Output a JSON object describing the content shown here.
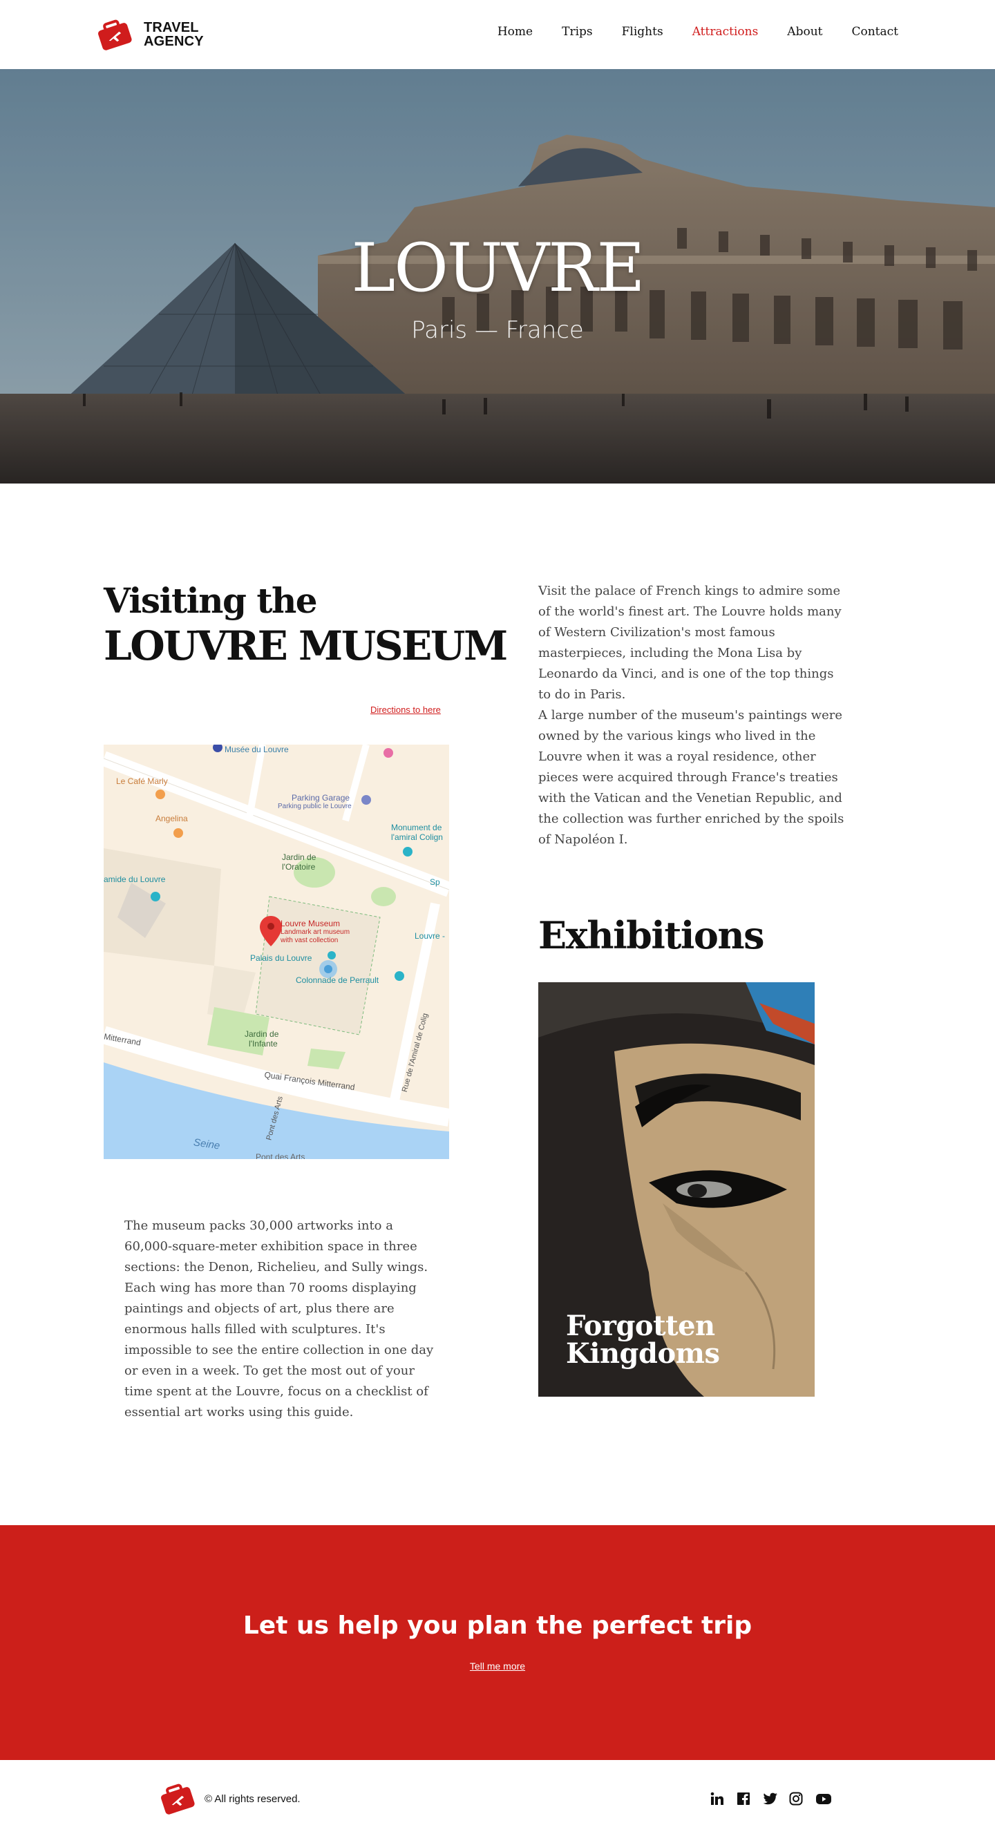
{
  "brand": {
    "name_line1": "TRAVEL",
    "name_line2": "AGENCY",
    "logo_icon": "suitcase-plane-icon",
    "color": "#d01c1c"
  },
  "nav": {
    "items": [
      {
        "label": "Home",
        "active": false
      },
      {
        "label": "Trips",
        "active": false
      },
      {
        "label": "Flights",
        "active": false
      },
      {
        "label": "Attractions",
        "active": true
      },
      {
        "label": "About",
        "active": false
      },
      {
        "label": "Contact",
        "active": false
      }
    ]
  },
  "hero": {
    "title": "LOUVRE",
    "subtitle": "Paris — France"
  },
  "visiting": {
    "heading_line1": "Visiting the",
    "heading_line2": "LOUVRE MUSEUM",
    "directions_link": "Directions to here",
    "paragraph1": "Visit the palace of French kings to admire some of the world's finest art. The Louvre holds many of Western Civilization's most famous masterpieces, including the Mona Lisa by Leonardo da Vinci, and is one of the top things to do in Paris.",
    "paragraph2": "A large number of the museum's paintings were owned by the various kings who lived in the Louvre when it was a royal residence, other pieces were acquired through France's treaties with the Vatican and the Venetian Republic, and the collection was further enriched by the spoils of Napoléon I.",
    "paragraph3": "The museum packs 30,000 artworks into a 60,000-square-meter exhibition space in three sections: the Denon, Richelieu, and Sully wings. Each wing has more than 70 rooms displaying paintings and objects of art, plus there are enormous halls filled with sculptures. It's impossible to see the entire collection in one day or even in a week. To get the most out of your time spent at the Louvre, focus on a checklist of essential art works using this guide."
  },
  "map": {
    "labels": {
      "musee": "Musée du Louvre",
      "cafe": "Le Café Marly",
      "angelina": "Angelina",
      "parking": "Parking Garage",
      "parking_sub": "Parking public le Louvre",
      "monument": "Monument de",
      "monument2": "l'amiral Colign",
      "jardin_oratoire": "Jardin de",
      "jardin_oratoire2": "l'Oratoire",
      "pyramide": "amide du Louvre",
      "louvre_museum": "Louvre Museum",
      "louvre_museum_sub1": "Landmark art museum",
      "louvre_museum_sub2": "with vast collection",
      "palais": "Palais du Louvre",
      "colonnade": "Colonnade de Perrault",
      "louvre_edge": "Louvre -",
      "jardin_infante": "Jardin de",
      "jardin_infante2": "l'Infante",
      "mitterrand": "Mitterrand",
      "quai": "Quai François Mitterrand",
      "seine": "Seine",
      "pont": "Pont des Arts",
      "pont2": "Pont des Arts",
      "amiral": "Rue de l'Amiral de Colig",
      "sp": "Sp"
    },
    "colors": {
      "water": "#aad3f5",
      "park": "#c9e6b0",
      "pin": "#e53935"
    }
  },
  "exhibitions": {
    "title": "Exhibitions",
    "card_title": "Forgotten Kingdoms"
  },
  "cta": {
    "title": "Let us help you plan the perfect trip",
    "link": "Tell me more",
    "color": "#cc1f1a"
  },
  "footer": {
    "copyright": "© All rights reserved.",
    "socials": [
      "linkedin-icon",
      "facebook-icon",
      "twitter-icon",
      "instagram-icon",
      "youtube-icon"
    ]
  }
}
